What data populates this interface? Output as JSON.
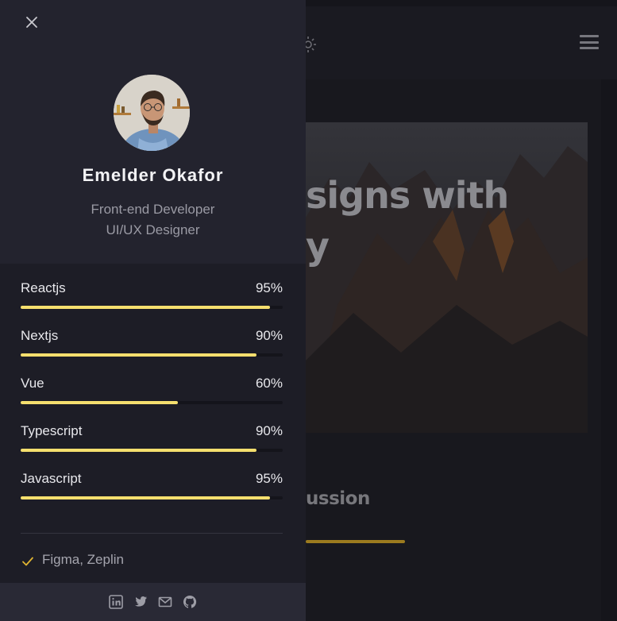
{
  "background": {
    "hero_title_line1": "signs with",
    "hero_title_line2": "y",
    "section_heading": "ussion"
  },
  "sidebar": {
    "close_icon": "close-icon",
    "profile": {
      "name": "Emelder Okafor",
      "role_line1": "Front-end Developer",
      "role_line2": "UI/UX Designer"
    },
    "skills": [
      {
        "label": "Reactjs",
        "percent_label": "95%",
        "level": 0.95
      },
      {
        "label": "Nextjs",
        "percent_label": "90%",
        "level": 0.9
      },
      {
        "label": "Vue",
        "percent_label": "60%",
        "level": 0.6
      },
      {
        "label": "Typescript",
        "percent_label": "90%",
        "level": 0.9
      },
      {
        "label": "Javascript",
        "percent_label": "95%",
        "level": 0.95
      }
    ],
    "tools": [
      {
        "label": "Figma, Zeplin",
        "icon": "check-icon"
      }
    ],
    "social": [
      "linkedin-icon",
      "twitter-icon",
      "mail-icon",
      "github-icon"
    ]
  },
  "colors": {
    "accent": "#f5df6e",
    "check": "#e0b431",
    "sidebar_bg": "#23232e"
  }
}
